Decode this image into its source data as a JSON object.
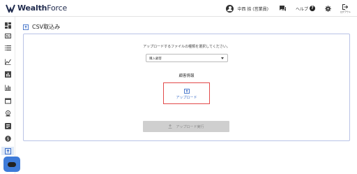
{
  "app": {
    "logo_part1": "Wealth",
    "logo_part2": "Force"
  },
  "header": {
    "user_name": "中西 捺 (営業員)",
    "help_label": "ヘルプ",
    "help_glyph": "?",
    "logout_label": "ログアウト"
  },
  "sidebar": {
    "items": [
      {
        "icon": "dashboard-icon"
      },
      {
        "icon": "contact-card-icon"
      },
      {
        "icon": "list-icon"
      },
      {
        "icon": "line-chart-icon"
      },
      {
        "icon": "bar-chart-icon"
      },
      {
        "icon": "bar-chart-outline-icon"
      },
      {
        "icon": "window-icon"
      },
      {
        "icon": "money-icon"
      },
      {
        "icon": "report-icon"
      },
      {
        "icon": "dollar-icon"
      },
      {
        "icon": "upload-file-icon",
        "active": true
      }
    ]
  },
  "page": {
    "title": "CSV取込み"
  },
  "form": {
    "instruction": "アップロードするファイルの種類を選択してください。",
    "select_value": "購入顧客",
    "section_label": "顧客情報",
    "upload_label": "アップロード",
    "exec_label": "アップロード実行",
    "exec_enabled": false
  },
  "colors": {
    "brand_navy": "#1f2a4d",
    "accent_blue": "#3d7bd9",
    "upload_border_red": "#e24a4a",
    "card_border": "#b9c3e6",
    "active_sidebar_bg": "#dfe9f7",
    "disabled_button": "#cfcfcf"
  }
}
